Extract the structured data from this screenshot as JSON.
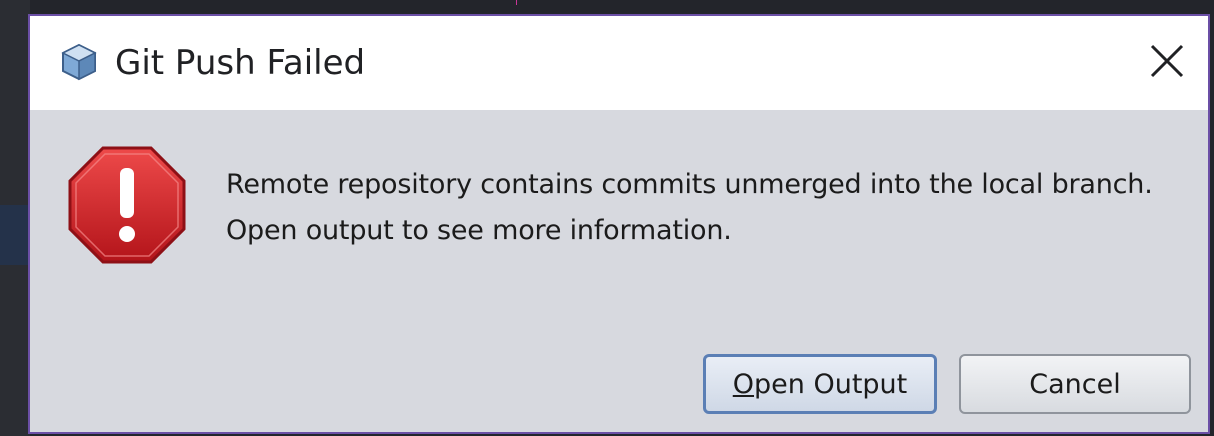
{
  "dialog": {
    "title": "Git Push Failed",
    "title_icon": "cube-icon",
    "close_icon": "close-icon",
    "message_icon": "error-octagon-icon",
    "message_lines": [
      "Remote repository contains commits unmerged into the local branch.",
      "Open output to see more information."
    ],
    "buttons": {
      "open_output": {
        "mnemonic": "O",
        "rest": "pen Output"
      },
      "cancel": "Cancel"
    }
  },
  "colors": {
    "dialog_border": "#6b4fa6",
    "dialog_body": "#d7d9df",
    "error_red": "#d32f2f",
    "primary_button_border": "#5b7fb5"
  }
}
